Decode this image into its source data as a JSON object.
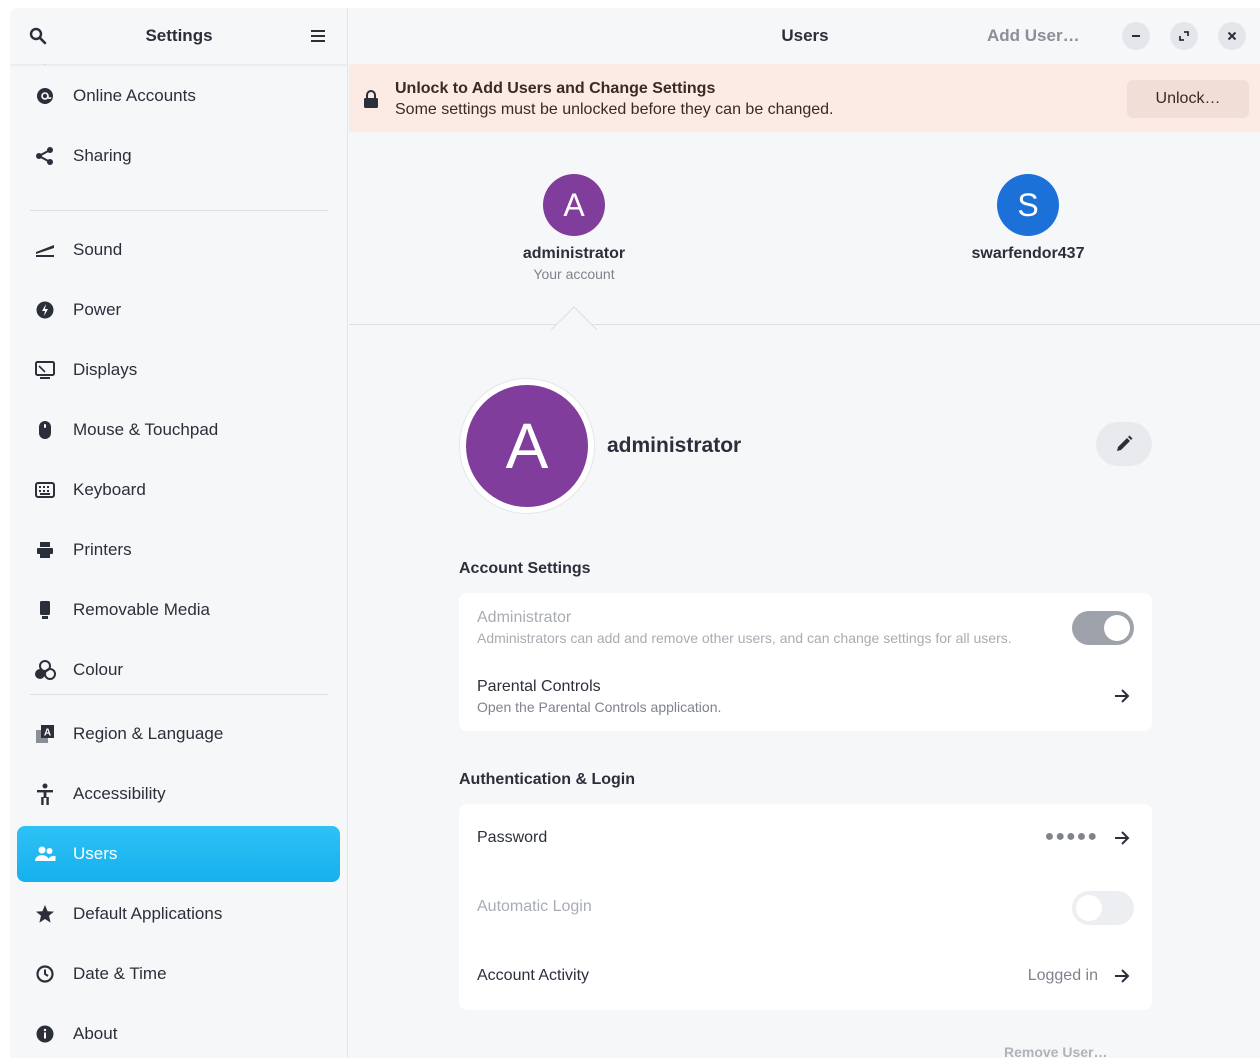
{
  "sidebar": {
    "title": "Settings",
    "items": [
      {
        "label": "Online Accounts",
        "icon": "at-sign-icon"
      },
      {
        "label": "Sharing",
        "icon": "share-icon"
      },
      {
        "label": "Sound",
        "icon": "sound-icon"
      },
      {
        "label": "Power",
        "icon": "power-icon"
      },
      {
        "label": "Displays",
        "icon": "display-icon"
      },
      {
        "label": "Mouse & Touchpad",
        "icon": "mouse-icon"
      },
      {
        "label": "Keyboard",
        "icon": "keyboard-icon"
      },
      {
        "label": "Printers",
        "icon": "printer-icon"
      },
      {
        "label": "Removable Media",
        "icon": "usb-drive-icon"
      },
      {
        "label": "Colour",
        "icon": "colour-icon"
      },
      {
        "label": "Region & Language",
        "icon": "region-icon"
      },
      {
        "label": "Accessibility",
        "icon": "accessibility-icon"
      },
      {
        "label": "Users",
        "icon": "users-icon"
      },
      {
        "label": "Default Applications",
        "icon": "star-icon"
      },
      {
        "label": "Date & Time",
        "icon": "clock-icon"
      },
      {
        "label": "About",
        "icon": "info-icon"
      }
    ],
    "active": "Users"
  },
  "header": {
    "title": "Users",
    "add_user_label": "Add User…"
  },
  "banner": {
    "title": "Unlock to Add Users and Change Settings",
    "subtitle": "Some settings must be unlocked before they can be changed.",
    "unlock_label": "Unlock…"
  },
  "users": [
    {
      "initial": "A",
      "name": "administrator",
      "sub": "Your account",
      "color": "#813d9c"
    },
    {
      "initial": "S",
      "name": "swarfendor437",
      "sub": "",
      "color": "#1c71d8"
    }
  ],
  "selected_user": {
    "initial": "A",
    "name": "administrator",
    "color": "#813d9c"
  },
  "account_settings": {
    "title": "Account Settings",
    "administrator": {
      "title": "Administrator",
      "subtitle": "Administrators can add and remove other users, and can change settings for all users.",
      "enabled": true
    },
    "parental_controls": {
      "title": "Parental Controls",
      "subtitle": "Open the Parental Controls application."
    }
  },
  "auth": {
    "title": "Authentication & Login",
    "password": {
      "title": "Password",
      "value": "●●●●●"
    },
    "automatic_login": {
      "title": "Automatic Login",
      "enabled": false
    },
    "account_activity": {
      "title": "Account Activity",
      "value": "Logged in"
    }
  },
  "footer": {
    "remove_user_label": "Remove User…"
  },
  "colors": {
    "accent": "#16b0ee",
    "banner_bg": "#fbebe4"
  }
}
